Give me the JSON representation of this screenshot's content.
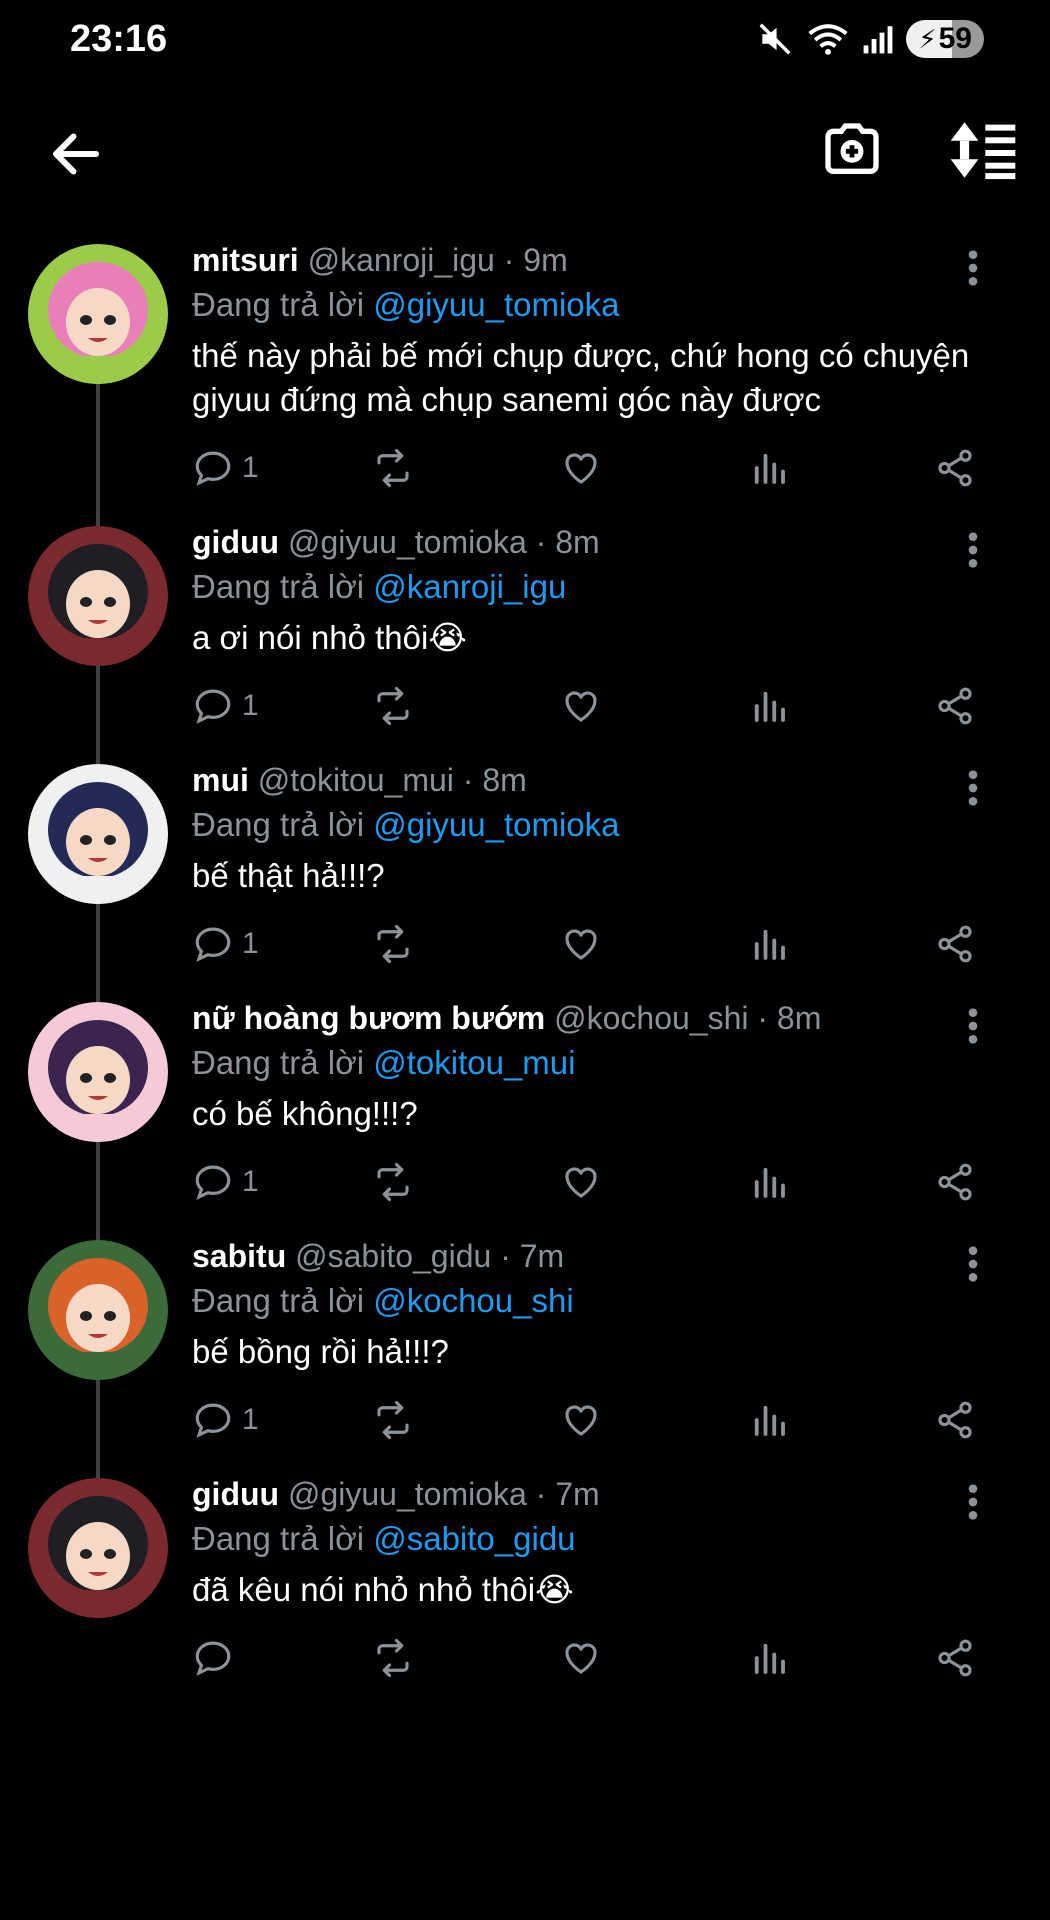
{
  "status": {
    "time": "23:16",
    "battery": "59"
  },
  "icons": {
    "back": "arrow-left-icon",
    "camera": "camera-add-icon",
    "sort": "sort-icon"
  },
  "replies": [
    {
      "name": "mitsuri",
      "meta": "@kanroji_igu · 9m",
      "replying_label": "Đang trả lời",
      "replying_to": "@giyuu_tomioka",
      "text": "thế này phải bế mới chụp được, chứ hong có chuyện giyuu đứng mà chụp sanemi góc này được",
      "reply_count": "1",
      "avatar_hair": "#e97fb8",
      "avatar_accent": "#9ccb4a"
    },
    {
      "name": "giduu",
      "meta": "@giyuu_tomioka · 8m",
      "replying_label": "Đang trả lời",
      "replying_to": "@kanroji_igu",
      "text": "a ơi nói nhỏ thôi😭",
      "reply_count": "1",
      "avatar_hair": "#1e1e24",
      "avatar_accent": "#7a2a2e"
    },
    {
      "name": "mui",
      "meta": "@tokitou_mui · 8m",
      "replying_label": "Đang trả lời",
      "replying_to": "@giyuu_tomioka",
      "text": "bế thật hả!!!?",
      "reply_count": "1",
      "avatar_hair": "#232a55",
      "avatar_accent": "#f0f0f2"
    },
    {
      "name": "nữ hoàng bươm bướm",
      "meta": "@kochou_shi · 8m",
      "replying_label": "Đang trả lời",
      "replying_to": "@tokitou_mui",
      "text": "có bế không!!!?",
      "reply_count": "1",
      "avatar_hair": "#3b2450",
      "avatar_accent": "#f5c9d6"
    },
    {
      "name": "sabitu",
      "meta": "@sabito_gidu · 7m",
      "replying_label": "Đang trả lời",
      "replying_to": "@kochou_shi",
      "text": "bế bồng rồi hả!!!?",
      "reply_count": "1",
      "avatar_hair": "#d9622b",
      "avatar_accent": "#3d6a3a"
    },
    {
      "name": "giduu",
      "meta": "@giyuu_tomioka · 7m",
      "replying_label": "Đang trả lời",
      "replying_to": "@sabito_gidu",
      "text": "đã kêu nói nhỏ nhỏ thôi😭",
      "reply_count": "",
      "avatar_hair": "#1e1e24",
      "avatar_accent": "#7a2a2e"
    }
  ]
}
